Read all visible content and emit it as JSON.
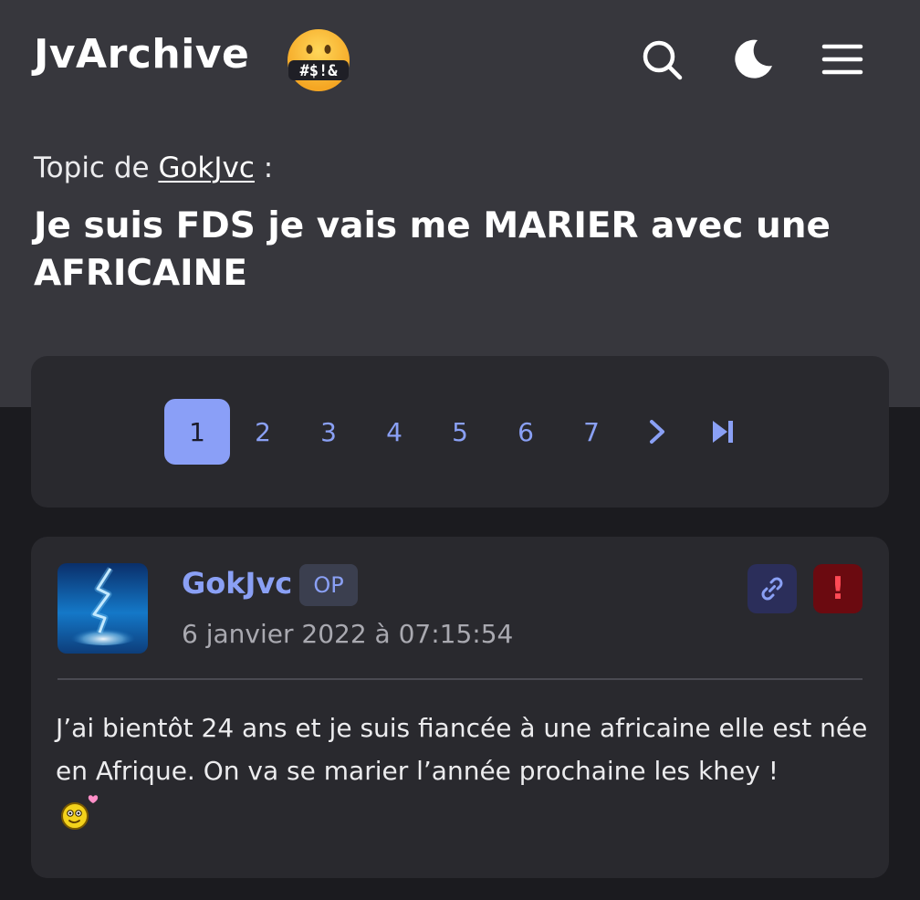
{
  "header": {
    "brand": "JvArchive",
    "brand_emoji_text": "#$!&",
    "icons": [
      "search-icon",
      "moon-icon",
      "menu-icon"
    ]
  },
  "topic": {
    "by_prefix": "Topic de",
    "by_author": "GokJvc",
    "by_suffix": " :",
    "title": "Je suis FDS je vais me MARIER avec une AFRICAINE"
  },
  "pagination": {
    "pages": [
      "1",
      "2",
      "3",
      "4",
      "5",
      "6",
      "7"
    ],
    "current": "1"
  },
  "post": {
    "author": "GokJvc",
    "badge": "OP",
    "date": "6 janvier 2022 à 07:15:54",
    "report_label": "!",
    "body": "J’ai bientôt 24 ans et je suis fiancée à une africaine elle est née en Afrique. On va se marier l’année prochaine les khey !"
  },
  "colors": {
    "accent": "#8aa0f5",
    "hero_bg": "#37373d",
    "page_bg": "#1b1b1f",
    "card_bg": "#29292e",
    "report_bg": "#6b0a10"
  }
}
